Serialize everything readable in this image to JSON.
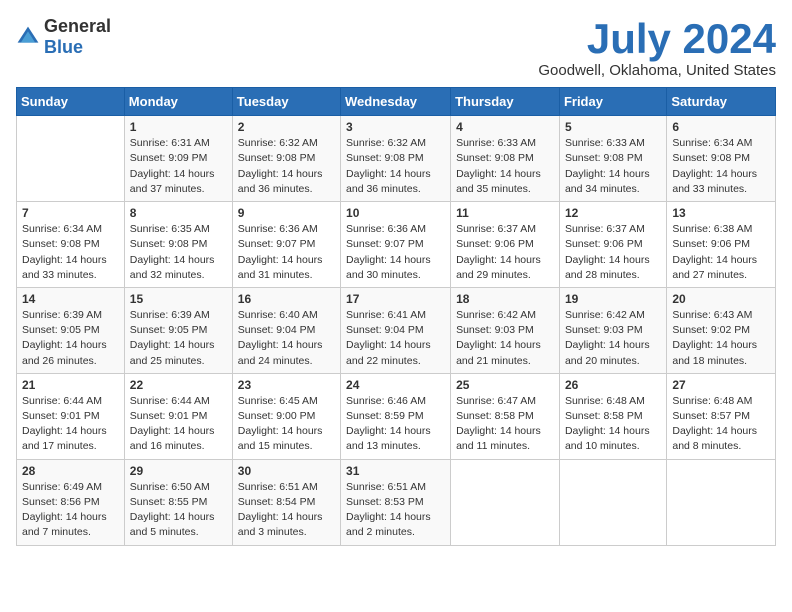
{
  "logo": {
    "general": "General",
    "blue": "Blue"
  },
  "title": {
    "month_year": "July 2024",
    "location": "Goodwell, Oklahoma, United States"
  },
  "weekdays": [
    "Sunday",
    "Monday",
    "Tuesday",
    "Wednesday",
    "Thursday",
    "Friday",
    "Saturday"
  ],
  "weeks": [
    [
      {
        "day": "",
        "sunrise": "",
        "sunset": "",
        "daylight": ""
      },
      {
        "day": "1",
        "sunrise": "Sunrise: 6:31 AM",
        "sunset": "Sunset: 9:09 PM",
        "daylight": "Daylight: 14 hours and 37 minutes."
      },
      {
        "day": "2",
        "sunrise": "Sunrise: 6:32 AM",
        "sunset": "Sunset: 9:08 PM",
        "daylight": "Daylight: 14 hours and 36 minutes."
      },
      {
        "day": "3",
        "sunrise": "Sunrise: 6:32 AM",
        "sunset": "Sunset: 9:08 PM",
        "daylight": "Daylight: 14 hours and 36 minutes."
      },
      {
        "day": "4",
        "sunrise": "Sunrise: 6:33 AM",
        "sunset": "Sunset: 9:08 PM",
        "daylight": "Daylight: 14 hours and 35 minutes."
      },
      {
        "day": "5",
        "sunrise": "Sunrise: 6:33 AM",
        "sunset": "Sunset: 9:08 PM",
        "daylight": "Daylight: 14 hours and 34 minutes."
      },
      {
        "day": "6",
        "sunrise": "Sunrise: 6:34 AM",
        "sunset": "Sunset: 9:08 PM",
        "daylight": "Daylight: 14 hours and 33 minutes."
      }
    ],
    [
      {
        "day": "7",
        "sunrise": "Sunrise: 6:34 AM",
        "sunset": "Sunset: 9:08 PM",
        "daylight": "Daylight: 14 hours and 33 minutes."
      },
      {
        "day": "8",
        "sunrise": "Sunrise: 6:35 AM",
        "sunset": "Sunset: 9:08 PM",
        "daylight": "Daylight: 14 hours and 32 minutes."
      },
      {
        "day": "9",
        "sunrise": "Sunrise: 6:36 AM",
        "sunset": "Sunset: 9:07 PM",
        "daylight": "Daylight: 14 hours and 31 minutes."
      },
      {
        "day": "10",
        "sunrise": "Sunrise: 6:36 AM",
        "sunset": "Sunset: 9:07 PM",
        "daylight": "Daylight: 14 hours and 30 minutes."
      },
      {
        "day": "11",
        "sunrise": "Sunrise: 6:37 AM",
        "sunset": "Sunset: 9:06 PM",
        "daylight": "Daylight: 14 hours and 29 minutes."
      },
      {
        "day": "12",
        "sunrise": "Sunrise: 6:37 AM",
        "sunset": "Sunset: 9:06 PM",
        "daylight": "Daylight: 14 hours and 28 minutes."
      },
      {
        "day": "13",
        "sunrise": "Sunrise: 6:38 AM",
        "sunset": "Sunset: 9:06 PM",
        "daylight": "Daylight: 14 hours and 27 minutes."
      }
    ],
    [
      {
        "day": "14",
        "sunrise": "Sunrise: 6:39 AM",
        "sunset": "Sunset: 9:05 PM",
        "daylight": "Daylight: 14 hours and 26 minutes."
      },
      {
        "day": "15",
        "sunrise": "Sunrise: 6:39 AM",
        "sunset": "Sunset: 9:05 PM",
        "daylight": "Daylight: 14 hours and 25 minutes."
      },
      {
        "day": "16",
        "sunrise": "Sunrise: 6:40 AM",
        "sunset": "Sunset: 9:04 PM",
        "daylight": "Daylight: 14 hours and 24 minutes."
      },
      {
        "day": "17",
        "sunrise": "Sunrise: 6:41 AM",
        "sunset": "Sunset: 9:04 PM",
        "daylight": "Daylight: 14 hours and 22 minutes."
      },
      {
        "day": "18",
        "sunrise": "Sunrise: 6:42 AM",
        "sunset": "Sunset: 9:03 PM",
        "daylight": "Daylight: 14 hours and 21 minutes."
      },
      {
        "day": "19",
        "sunrise": "Sunrise: 6:42 AM",
        "sunset": "Sunset: 9:03 PM",
        "daylight": "Daylight: 14 hours and 20 minutes."
      },
      {
        "day": "20",
        "sunrise": "Sunrise: 6:43 AM",
        "sunset": "Sunset: 9:02 PM",
        "daylight": "Daylight: 14 hours and 18 minutes."
      }
    ],
    [
      {
        "day": "21",
        "sunrise": "Sunrise: 6:44 AM",
        "sunset": "Sunset: 9:01 PM",
        "daylight": "Daylight: 14 hours and 17 minutes."
      },
      {
        "day": "22",
        "sunrise": "Sunrise: 6:44 AM",
        "sunset": "Sunset: 9:01 PM",
        "daylight": "Daylight: 14 hours and 16 minutes."
      },
      {
        "day": "23",
        "sunrise": "Sunrise: 6:45 AM",
        "sunset": "Sunset: 9:00 PM",
        "daylight": "Daylight: 14 hours and 15 minutes."
      },
      {
        "day": "24",
        "sunrise": "Sunrise: 6:46 AM",
        "sunset": "Sunset: 8:59 PM",
        "daylight": "Daylight: 14 hours and 13 minutes."
      },
      {
        "day": "25",
        "sunrise": "Sunrise: 6:47 AM",
        "sunset": "Sunset: 8:58 PM",
        "daylight": "Daylight: 14 hours and 11 minutes."
      },
      {
        "day": "26",
        "sunrise": "Sunrise: 6:48 AM",
        "sunset": "Sunset: 8:58 PM",
        "daylight": "Daylight: 14 hours and 10 minutes."
      },
      {
        "day": "27",
        "sunrise": "Sunrise: 6:48 AM",
        "sunset": "Sunset: 8:57 PM",
        "daylight": "Daylight: 14 hours and 8 minutes."
      }
    ],
    [
      {
        "day": "28",
        "sunrise": "Sunrise: 6:49 AM",
        "sunset": "Sunset: 8:56 PM",
        "daylight": "Daylight: 14 hours and 7 minutes."
      },
      {
        "day": "29",
        "sunrise": "Sunrise: 6:50 AM",
        "sunset": "Sunset: 8:55 PM",
        "daylight": "Daylight: 14 hours and 5 minutes."
      },
      {
        "day": "30",
        "sunrise": "Sunrise: 6:51 AM",
        "sunset": "Sunset: 8:54 PM",
        "daylight": "Daylight: 14 hours and 3 minutes."
      },
      {
        "day": "31",
        "sunrise": "Sunrise: 6:51 AM",
        "sunset": "Sunset: 8:53 PM",
        "daylight": "Daylight: 14 hours and 2 minutes."
      },
      {
        "day": "",
        "sunrise": "",
        "sunset": "",
        "daylight": ""
      },
      {
        "day": "",
        "sunrise": "",
        "sunset": "",
        "daylight": ""
      },
      {
        "day": "",
        "sunrise": "",
        "sunset": "",
        "daylight": ""
      }
    ]
  ]
}
